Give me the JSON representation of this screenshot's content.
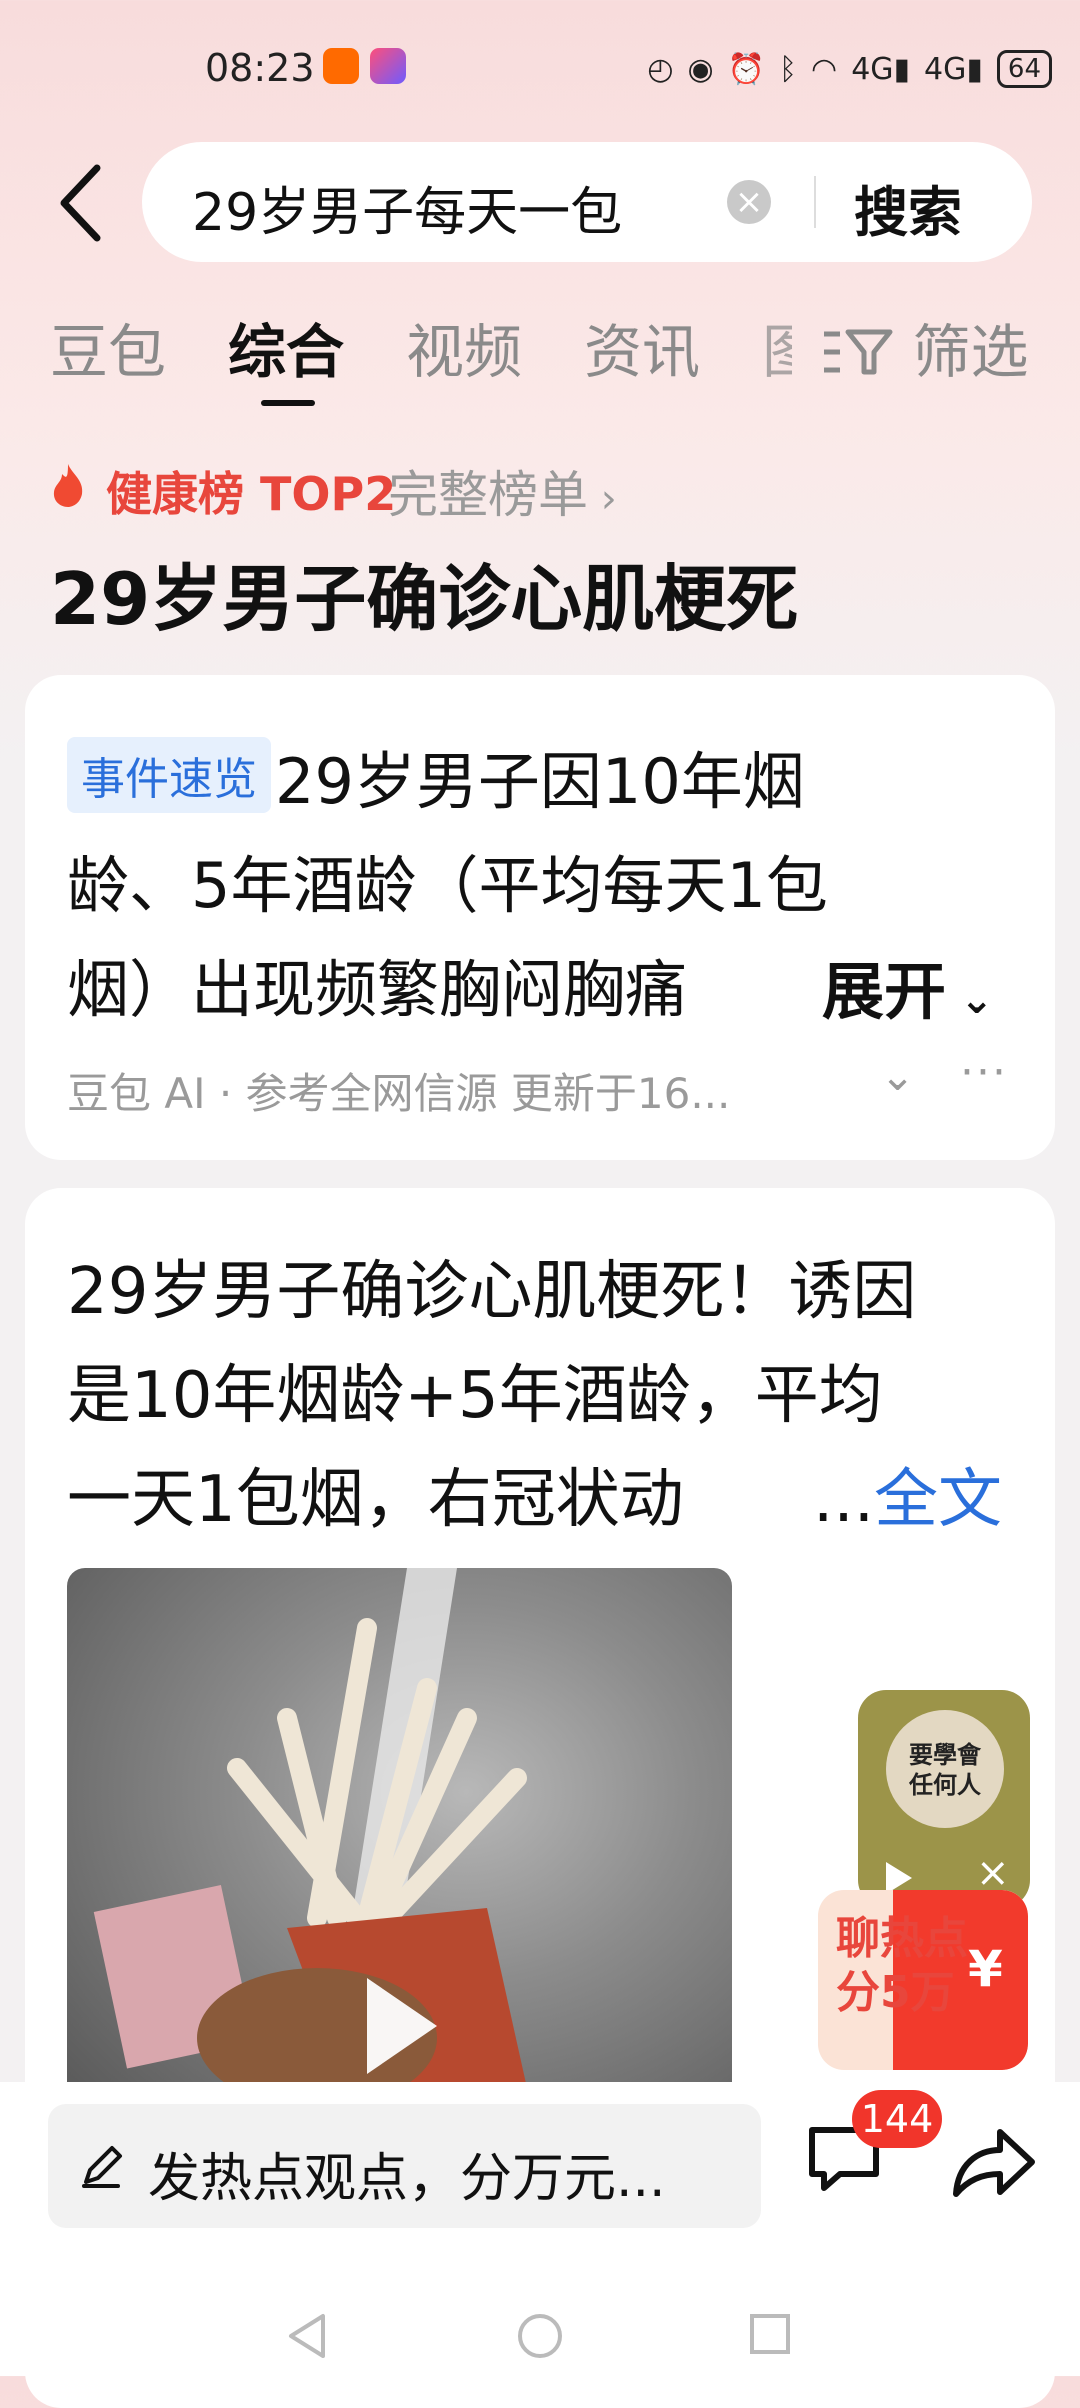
{
  "status_bar": {
    "time": "08:23",
    "battery": "64",
    "network_1": "4G",
    "network_2": "4G"
  },
  "search": {
    "query": "29岁男子每天一包",
    "button_label": "搜索"
  },
  "tabs": [
    {
      "label": "豆包"
    },
    {
      "label": "综合"
    },
    {
      "label": "视频"
    },
    {
      "label": "资讯"
    },
    {
      "label": "图"
    }
  ],
  "filter_label": "筛选",
  "hot_rank": {
    "label": "健康榜 TOP2",
    "link": "完整榜单",
    "topic": "29岁男子确诊心肌梗死"
  },
  "summary_card": {
    "tag": "事件速览",
    "line1": "29岁男子因10年烟",
    "line2": "龄、5年酒龄（平均每天1包",
    "line3": "烟）出现频繁胸闷胸痛",
    "expand": "展开",
    "meta": "豆包 AI · 参考全网信源 更新于16..."
  },
  "post_card": {
    "line1": "29岁男子确诊心肌梗死！诱因",
    "line2": "是10年烟龄+5年酒龄，平均",
    "line3": "一天1包烟，右冠状动",
    "ellipsis": "...",
    "fulltext": "全文"
  },
  "float_widget": {
    "line1": "要學會",
    "line2": "任何人"
  },
  "promo": {
    "line1": "聊热点",
    "line2": "分5万",
    "yen": "¥"
  },
  "bottom_bar": {
    "comment_placeholder": "发热点观点，分万元...",
    "comment_count": "144"
  },
  "colors": {
    "accent_red": "#e8463c",
    "link_blue": "#2a6fdb",
    "badge_red": "#f1352b"
  }
}
